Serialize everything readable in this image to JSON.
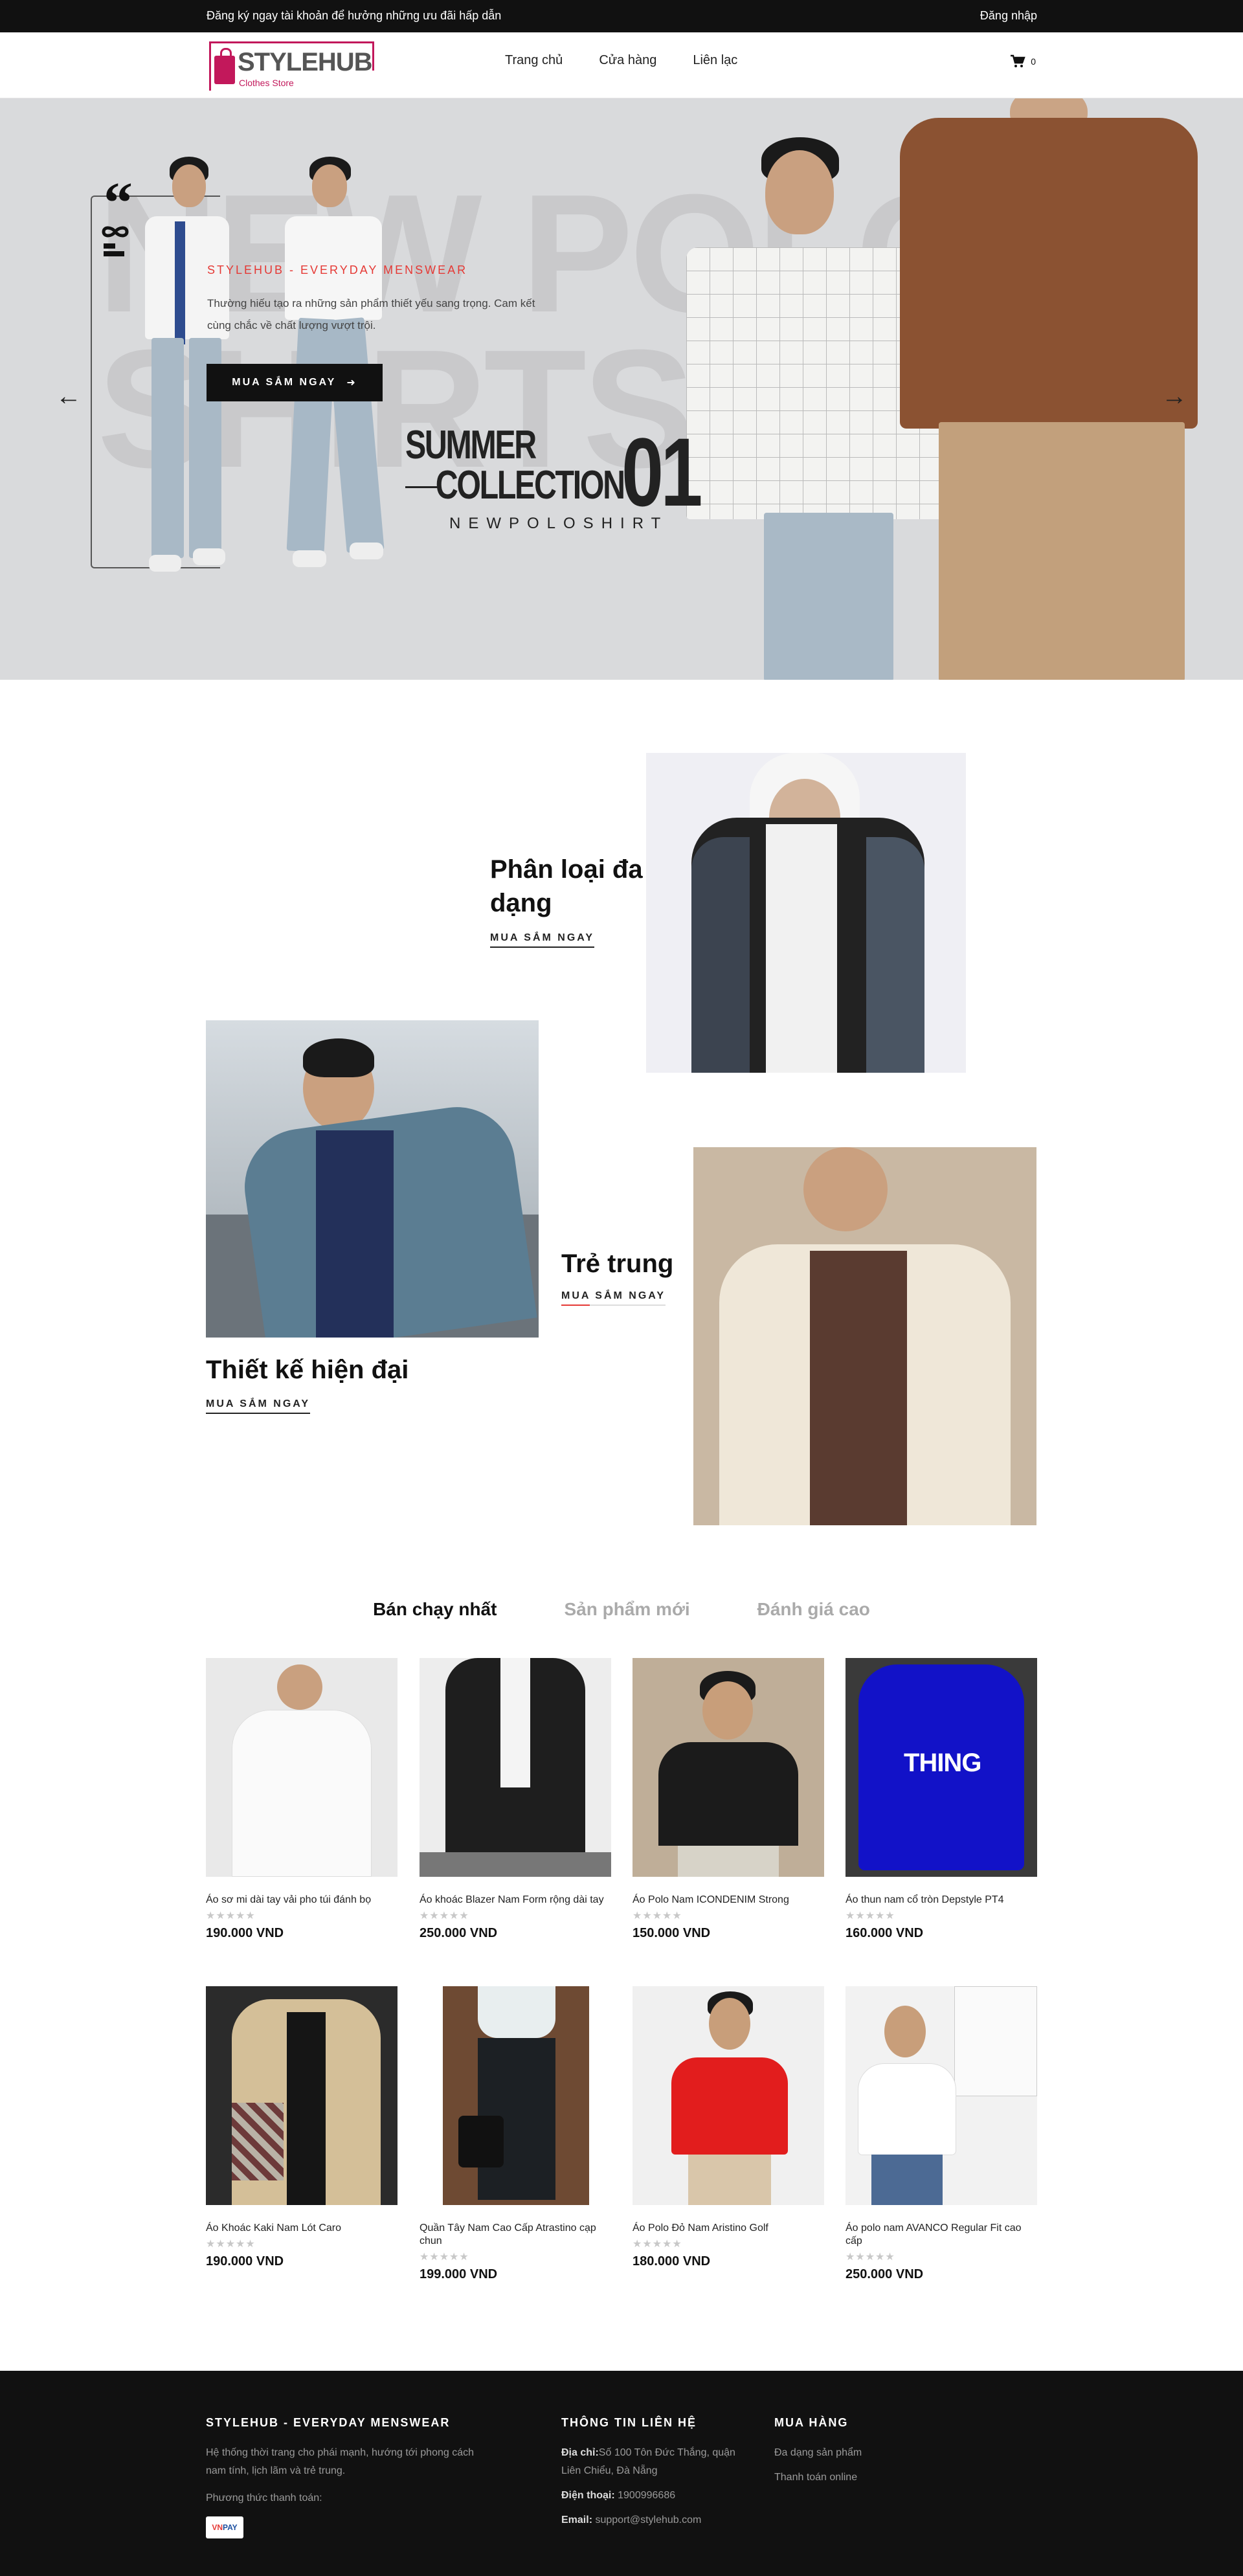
{
  "topbar": {
    "promo": "Đăng ký ngay tài khoản để hưởng những ưu đãi hấp dẫn",
    "login": "Đăng nhập"
  },
  "header": {
    "logo_brand": "STYLEHUB",
    "logo_sub": "Clothes Store",
    "nav": [
      "Trang chủ",
      "Cửa hàng",
      "Liên lạc"
    ],
    "cart_count": "0"
  },
  "hero": {
    "bg_text_1": "NEW POLO",
    "bg_text_2": "SHIRTS",
    "eyebrow": "STYLEHUB - EVERYDAY MENSWEAR",
    "description": "Thường hiếu tạo ra những sản phẩm thiết yếu sang trọng. Cam kết cùng chắc về chất lượng vượt trội.",
    "cta": "MUA SẮM NGAY",
    "summer_line1": "SUMMER",
    "summer_line2": "COLLECTION",
    "summer_number": "01",
    "summer_line3": "NEWPOLOSHIRT"
  },
  "categories": [
    {
      "title": "Phân loại đa dạng",
      "link": "MUA SẮM NGAY"
    },
    {
      "title": "Thiết kế hiện đại",
      "link": "MUA SẮM NGAY"
    },
    {
      "title": "Trẻ trung",
      "link": "MUA SẮM NGAY"
    }
  ],
  "tabs": [
    "Bán chạy nhất",
    "Sản phẩm mới",
    "Đánh giá cao"
  ],
  "products": [
    {
      "name": "Áo sơ mi dài tay vải pho túi đánh bọ",
      "price": "190.000 VND",
      "rating": 0
    },
    {
      "name": "Áo khoác Blazer Nam Form rộng dài tay",
      "price": "250.000 VND",
      "rating": 0
    },
    {
      "name": "Áo Polo Nam ICONDENIM Strong",
      "price": "150.000 VND",
      "rating": 0
    },
    {
      "name": "Áo thun nam cổ tròn Depstyle PT4",
      "price": "160.000 VND",
      "rating": 0
    },
    {
      "name": "Áo Khoác Kaki Nam Lót Caro",
      "price": "190.000 VND",
      "rating": 0
    },
    {
      "name": "Quần Tây Nam Cao Cấp Atrastino cạp chun",
      "price": "199.000 VND",
      "rating": 0
    },
    {
      "name": "Áo Polo Đỏ Nam Aristino Golf",
      "price": "180.000 VND",
      "rating": 0
    },
    {
      "name": "Áo polo nam AVANCO Regular Fit cao cấp",
      "price": "250.000 VND",
      "rating": 0
    }
  ],
  "product_graphic_text": "THING",
  "footer": {
    "brand_title": "STYLEHUB - EVERYDAY MENSWEAR",
    "brand_desc": "Hệ thống thời trang cho phái mạnh, hướng tới phong cách nam tính, lịch lãm và trẻ trung.",
    "payment_label": "Phương thức thanh toán:",
    "payment_logo": "VNPAY",
    "contact_title": "THÔNG TIN LIÊN HỆ",
    "address_label": "Địa chỉ:",
    "address": "Số 100 Tôn Đức Thắng, quận Liên Chiểu, Đà Nẵng",
    "phone_label": "Điện thoại:",
    "phone": "1900996686",
    "email_label": "Email:",
    "email": "support@stylehub.com",
    "shop_title": "MUA HÀNG",
    "shop_links": [
      "Đa dạng sản phẩm",
      "Thanh toán online"
    ]
  },
  "colors": {
    "accent": "#e53935",
    "brand": "#c2185b",
    "dark": "#111111"
  }
}
